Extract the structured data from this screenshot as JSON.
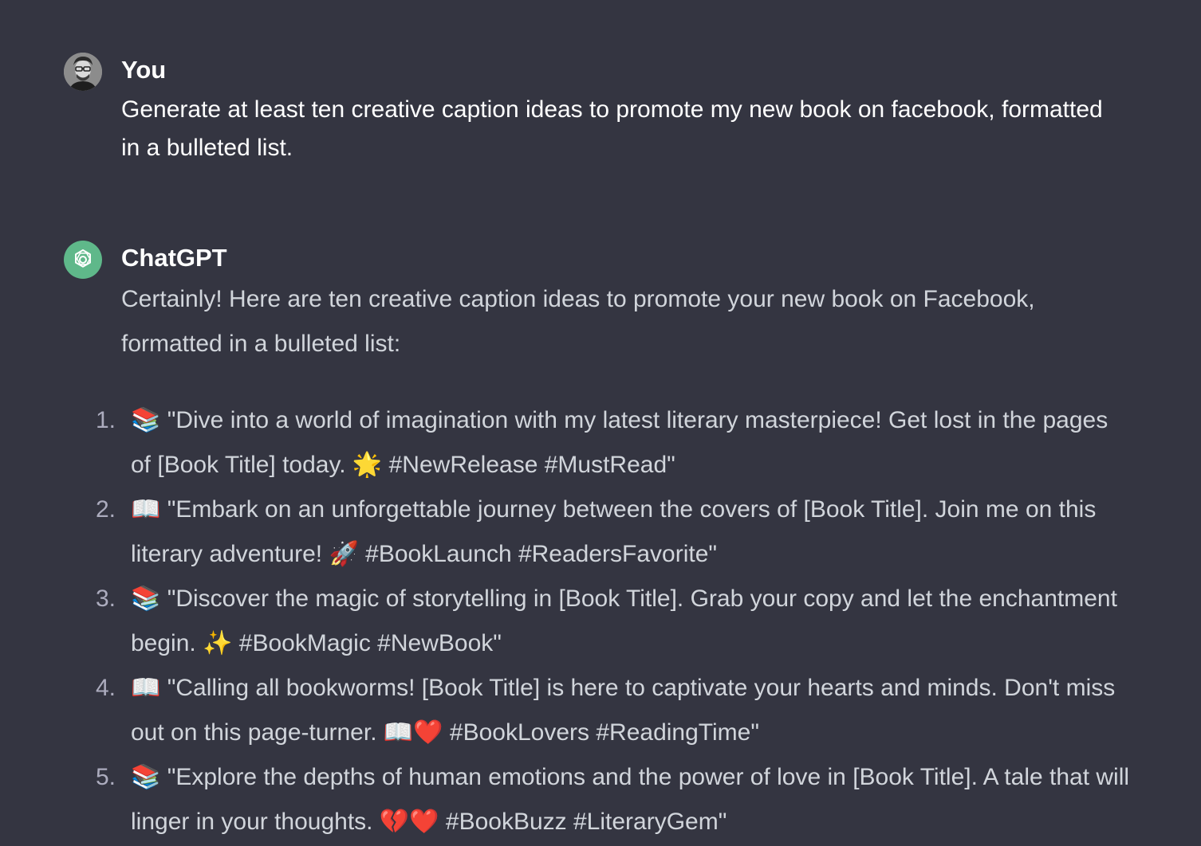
{
  "user_message": {
    "author": "You",
    "text": "Generate at least ten creative caption ideas to promote my new book on facebook, formatted in a bulleted list."
  },
  "assistant_message": {
    "author": "ChatGPT",
    "intro": "Certainly! Here are ten creative caption ideas to promote your new book on Facebook, formatted in a bulleted list:",
    "items": [
      {
        "num": "1.",
        "text": "📚 \"Dive into a world of imagination with my latest literary masterpiece! Get lost in the pages of [Book Title] today. 🌟 #NewRelease #MustRead\""
      },
      {
        "num": "2.",
        "text": "📖 \"Embark on an unforgettable journey between the covers of [Book Title]. Join me on this literary adventure! 🚀 #BookLaunch #ReadersFavorite\""
      },
      {
        "num": "3.",
        "text": "📚 \"Discover the magic of storytelling in [Book Title]. Grab your copy and let the enchantment begin. ✨ #BookMagic #NewBook\""
      },
      {
        "num": "4.",
        "text": "📖 \"Calling all bookworms! [Book Title] is here to captivate your hearts and minds. Don't miss out on this page-turner. 📖❤️ #BookLovers #ReadingTime\""
      },
      {
        "num": "5.",
        "text": "📚 \"Explore the depths of human emotions and the power of love in [Book Title]. A tale that will linger in your thoughts. 💔❤️ #BookBuzz #LiteraryGem\""
      }
    ]
  }
}
